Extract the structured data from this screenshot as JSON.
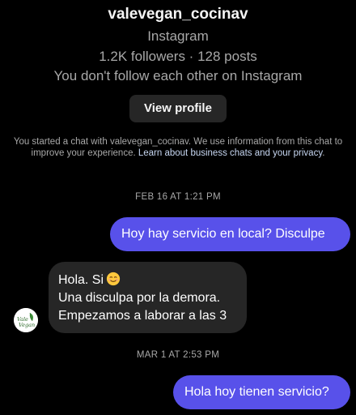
{
  "profile": {
    "username": "valevegan_cocinav",
    "platform": "Instagram",
    "stats": "1.2K followers · 128 posts",
    "follow_status": "You don't follow each other on Instagram",
    "view_profile_label": "View profile"
  },
  "notice": {
    "text": "You started a chat with valevegan_cocinav. We use information from this chat to improve your experience. ",
    "link_text": "Learn about business chats and your privacy",
    "suffix": "."
  },
  "avatar": {
    "logo_text_line1": "Vale",
    "logo_text_line2": "Vegan"
  },
  "messages": {
    "timestamp1": "FEB 16 AT 1:21 PM",
    "out1": "Hoy hay servicio en local? Disculpe",
    "in1_line1": "Hola. Si",
    "in1_emoji": "smiling-face-emoji",
    "in1_line2": "Una disculpa por la demora.",
    "in1_line3": "Empezamos a laborar a las 3",
    "timestamp2": "MAR 1 AT 2:53 PM",
    "out2": "Hola hoy tienen servicio?"
  },
  "colors": {
    "background": "#000000",
    "outgoing_bubble": "#5851ea",
    "incoming_bubble": "#262626",
    "secondary_text": "#a8a8a8",
    "link": "#c7d7f2"
  }
}
